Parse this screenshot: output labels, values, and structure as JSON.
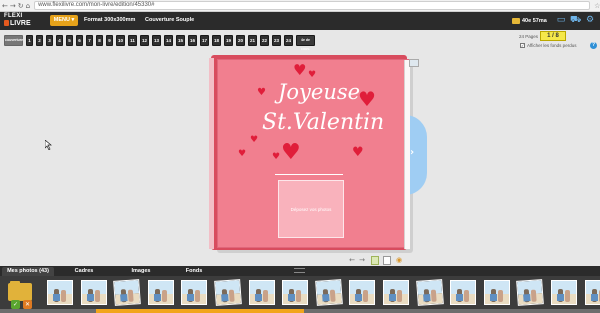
{
  "browser": {
    "back_icon": "back-arrow-icon",
    "forward_icon": "forward-arrow-icon",
    "reload_icon": "reload-icon",
    "home_icon": "home-icon",
    "url": "www.flexilivre.com/mon-livre/edition/45330#"
  },
  "header": {
    "logo_top": "FLEXI",
    "logo_bottom": "LIVRE",
    "menu_label": "MENU ▾",
    "format": "Format 300x300mm",
    "cover": "Couverture Souple",
    "price": "40e 57ma",
    "icons": [
      "monitor-icon",
      "cart-icon",
      "gear-icon"
    ]
  },
  "pager": {
    "first_label": "couverture",
    "pages": [
      "1",
      "2",
      "3",
      "4",
      "5",
      "6",
      "7",
      "8",
      "9",
      "10",
      "11",
      "12",
      "13",
      "14",
      "15",
      "16",
      "17",
      "18",
      "19",
      "20",
      "21",
      "22",
      "23",
      "24"
    ],
    "last_label": "4e de couv."
  },
  "options": {
    "pages_label": "24 Pages",
    "pages_value": "1 / 8",
    "show_background_label": "Afficher les fonds perdus",
    "show_background_checked": true
  },
  "book": {
    "title_line1": "Joyeuse",
    "title_line2": "St.Valentin",
    "drop_label": "Déposez vos photos"
  },
  "bottom": {
    "tabs": [
      "Mes photos (43)",
      "Cadres",
      "Images",
      "Fonds"
    ],
    "thumbnail_count": 17,
    "colors": {
      "accent": "#f2a51c",
      "cover": "#f17f8f",
      "heart": "#e01e3a"
    }
  }
}
